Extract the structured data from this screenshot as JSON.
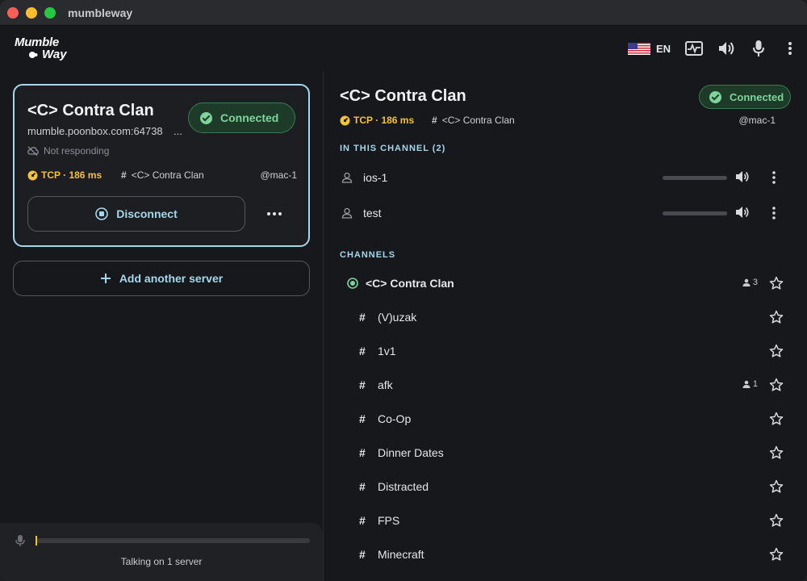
{
  "window": {
    "title": "mumbleway"
  },
  "logo": {
    "line1": "Mumble",
    "line2": "Way"
  },
  "toolbar": {
    "language": "EN",
    "icons": [
      "us-flag-icon",
      "network-monitor-icon",
      "speaker-icon",
      "microphone-icon",
      "more-vertical-icon"
    ]
  },
  "server_card": {
    "name": "<C> Contra Clan",
    "host": "mumble.poonbox.com:64738",
    "host_ellipsis": "...",
    "status": "Connected",
    "warning": "Not responding",
    "transport": "TCP · 186 ms",
    "channel": "<C> Contra Clan",
    "user": "@mac-1",
    "disconnect_label": "Disconnect"
  },
  "add_server_label": "Add another server",
  "talk_status": "Talking on 1 server",
  "channel_view": {
    "title": "<C> Contra Clan",
    "status": "Connected",
    "transport": "TCP · 186 ms",
    "channel": "<C> Contra Clan",
    "user": "@mac-1",
    "in_channel_heading": "IN THIS CHANNEL (2)",
    "users": [
      {
        "name": "ios-1"
      },
      {
        "name": "test"
      }
    ],
    "channels_heading": "CHANNELS",
    "root_channel": {
      "name": "<C> Contra Clan",
      "count": "3"
    },
    "channels": [
      {
        "name": "(V)uzak",
        "count": ""
      },
      {
        "name": "1v1",
        "count": ""
      },
      {
        "name": "afk",
        "count": "1"
      },
      {
        "name": "Co-Op",
        "count": ""
      },
      {
        "name": "Dinner Dates",
        "count": ""
      },
      {
        "name": "Distracted",
        "count": ""
      },
      {
        "name": "FPS",
        "count": ""
      },
      {
        "name": "Minecraft",
        "count": ""
      }
    ]
  },
  "colors": {
    "accent": "#a6d7ec",
    "success": "#7fd49b",
    "warning": "#f1c23a",
    "background": "#17181b"
  }
}
